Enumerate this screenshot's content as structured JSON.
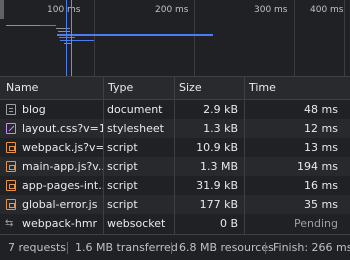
{
  "timeline": {
    "ticks": [
      "100 ms",
      "200 ms",
      "300 ms",
      "400 ms"
    ]
  },
  "table": {
    "columns": {
      "name": "Name",
      "type": "Type",
      "size": "Size",
      "time": "Time"
    },
    "rows": [
      {
        "icon": "document-icon",
        "name": "blog",
        "type": "document",
        "size": "2.9 kB",
        "time": "48 ms"
      },
      {
        "icon": "stylesheet-icon",
        "name": "layout.css?v=1...",
        "type": "stylesheet",
        "size": "1.3 kB",
        "time": "12 ms"
      },
      {
        "icon": "script-icon",
        "name": "webpack.js?v=...",
        "type": "script",
        "size": "10.9 kB",
        "time": "13 ms"
      },
      {
        "icon": "script-icon",
        "name": "main-app.js?v...",
        "type": "script",
        "size": "1.3 MB",
        "time": "194 ms"
      },
      {
        "icon": "script-icon",
        "name": "app-pages-int...",
        "type": "script",
        "size": "31.9 kB",
        "time": "16 ms"
      },
      {
        "icon": "script-icon",
        "name": "global-error.js",
        "type": "script",
        "size": "177 kB",
        "time": "35 ms"
      },
      {
        "icon": "websocket-icon",
        "name": "webpack-hmr",
        "type": "websocket",
        "size": "0 B",
        "time": "Pending"
      }
    ]
  },
  "status": {
    "requests": "7 requests",
    "transferred": "1.6 MB transferred",
    "resources": "6.8 MB resources",
    "finish": "Finish: 266 ms"
  },
  "colors": {
    "dcl_marker": "#4e7bf2",
    "load_marker": "#e46962",
    "bar_blue": "#4e7bf2",
    "bar_gray": "#8d9096"
  }
}
